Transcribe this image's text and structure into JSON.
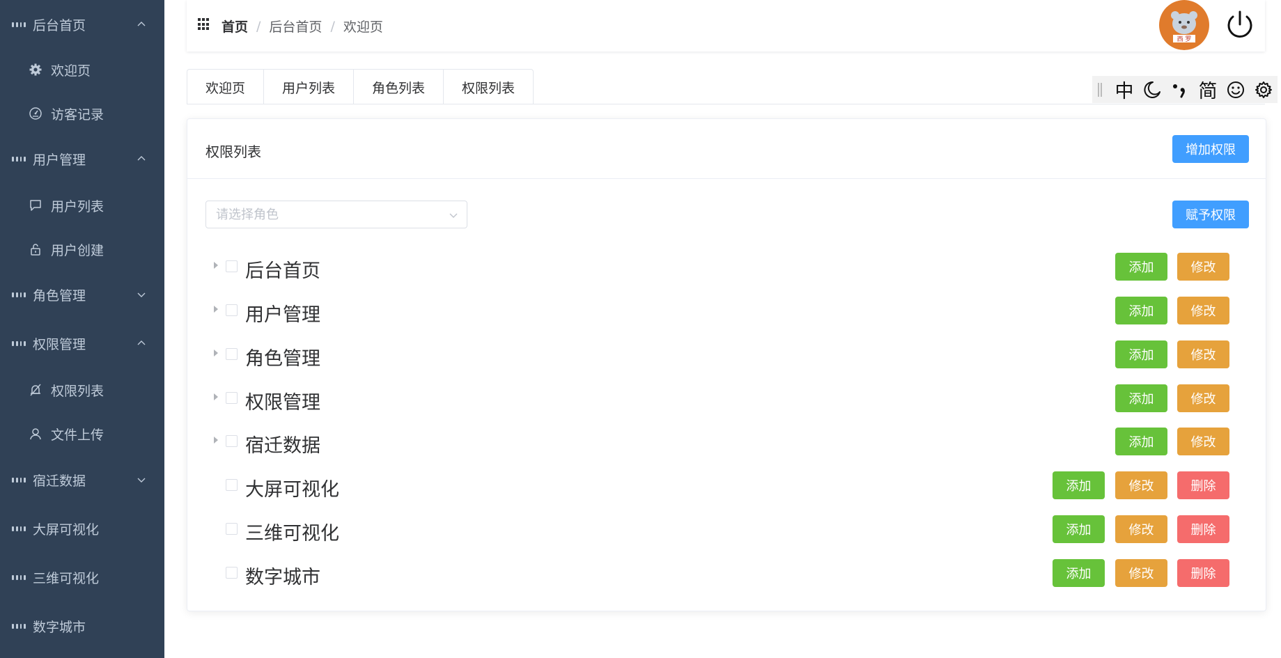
{
  "sidebar": {
    "items": [
      {
        "label": "后台首页",
        "type": "group",
        "icon": "grid-icon",
        "expanded": true
      },
      {
        "label": "欢迎页",
        "type": "sub",
        "icon": "gear-icon"
      },
      {
        "label": "访客记录",
        "type": "sub",
        "icon": "gauge-icon"
      },
      {
        "label": "用户管理",
        "type": "group",
        "icon": "grid-icon",
        "expanded": true
      },
      {
        "label": "用户列表",
        "type": "sub",
        "icon": "chat-icon"
      },
      {
        "label": "用户创建",
        "type": "sub",
        "icon": "unlock-icon"
      },
      {
        "label": "角色管理",
        "type": "group",
        "icon": "grid-icon",
        "expanded": false
      },
      {
        "label": "权限管理",
        "type": "group",
        "icon": "grid-icon",
        "expanded": true
      },
      {
        "label": "权限列表",
        "type": "sub",
        "icon": "bell-off-icon"
      },
      {
        "label": "文件上传",
        "type": "sub",
        "icon": "user-icon"
      },
      {
        "label": "宿迁数据",
        "type": "group",
        "icon": "grid-icon",
        "expanded": false
      },
      {
        "label": "大屏可视化",
        "type": "group",
        "icon": "grid-icon",
        "expanded": null
      },
      {
        "label": "三维可视化",
        "type": "group",
        "icon": "grid-icon",
        "expanded": null
      },
      {
        "label": "数字城市",
        "type": "group",
        "icon": "grid-icon",
        "expanded": null
      }
    ]
  },
  "header": {
    "breadcrumb": [
      "首页",
      "后台首页",
      "欢迎页"
    ],
    "separator": "/",
    "avatar_text": "西 罗"
  },
  "tabs": [
    "欢迎页",
    "用户列表",
    "角色列表",
    "权限列表"
  ],
  "toolbar": {
    "lang": "中",
    "simplified": "简",
    "icons": [
      "drag-handle-icon",
      "moon-icon",
      "punctuation-icon",
      "smile-icon",
      "gear-icon"
    ]
  },
  "card": {
    "title": "权限列表",
    "add_label": "增加权限",
    "grant_label": "赋予权限",
    "select_placeholder": "请选择角色"
  },
  "tree": [
    {
      "label": "后台首页",
      "expandable": true,
      "buttons": [
        "添加",
        "修改"
      ]
    },
    {
      "label": "用户管理",
      "expandable": true,
      "buttons": [
        "添加",
        "修改"
      ]
    },
    {
      "label": "角色管理",
      "expandable": true,
      "buttons": [
        "添加",
        "修改"
      ]
    },
    {
      "label": "权限管理",
      "expandable": true,
      "buttons": [
        "添加",
        "修改"
      ]
    },
    {
      "label": "宿迁数据",
      "expandable": true,
      "buttons": [
        "添加",
        "修改"
      ]
    },
    {
      "label": "大屏可视化",
      "expandable": false,
      "buttons": [
        "添加",
        "修改",
        "删除"
      ]
    },
    {
      "label": "三维可视化",
      "expandable": false,
      "buttons": [
        "添加",
        "修改",
        "删除"
      ]
    },
    {
      "label": "数字城市",
      "expandable": false,
      "buttons": [
        "添加",
        "修改",
        "删除"
      ]
    }
  ],
  "colors": {
    "sidebar_bg": "#304156",
    "sidebar_text": "#bfcbd9",
    "primary": "#409eff",
    "success": "#67c23a",
    "warning": "#e6a23c",
    "danger": "#f56c6c"
  }
}
